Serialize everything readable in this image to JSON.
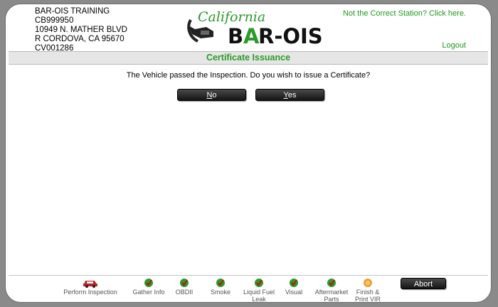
{
  "station": {
    "name": "BAR-OIS TRAINING",
    "id": "CB999950",
    "address": "10949 N. MATHER BLVD",
    "city": "R CORDOVA, CA 95670",
    "code": "CV001286"
  },
  "logo": {
    "script": "California",
    "brand_left": "B",
    "brand_mid": "A",
    "brand_right": "R-OIS"
  },
  "header": {
    "not_correct": "Not the Correct Station? Click here.",
    "logout": "Logout"
  },
  "page": {
    "title": "Certificate Issuance",
    "question": "The Vehicle passed the Inspection. Do you wish to issue a Certificate?",
    "no_first": "N",
    "no_rest": "o",
    "yes_first": "Y",
    "yes_rest": "es"
  },
  "steps": [
    {
      "label": "Perform Inspection",
      "status": "active"
    },
    {
      "label": "Gather Info",
      "status": "done"
    },
    {
      "label": "OBDII",
      "status": "done"
    },
    {
      "label": "Smoke",
      "status": "done"
    },
    {
      "label": "Liquid Fuel Leak",
      "status": "done"
    },
    {
      "label": "Visual",
      "status": "done"
    },
    {
      "label": "Aftermarket Parts",
      "status": "done"
    },
    {
      "label": "Finish & Print VIR",
      "status": "current"
    }
  ],
  "abort_label": "Abort",
  "colors": {
    "green": "#2a9a2a",
    "orange": "#f0a030",
    "dark_button": "#1a1a1a"
  }
}
